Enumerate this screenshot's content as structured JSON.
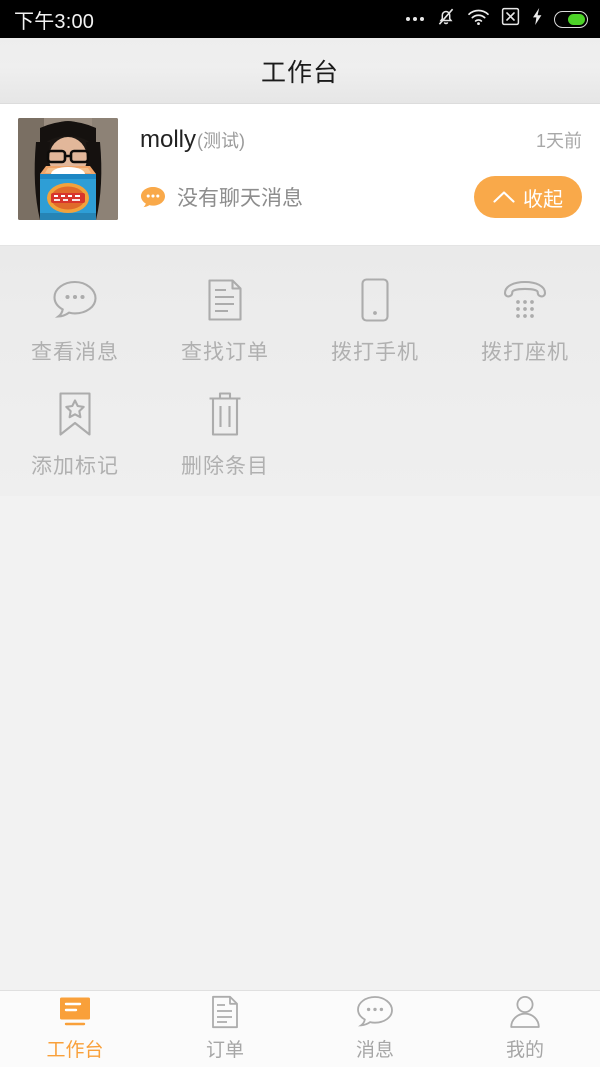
{
  "statusbar": {
    "time": "下午3:00",
    "icons": [
      "more-dots",
      "bell-muted-icon",
      "wifi-icon",
      "no-sim-icon",
      "charging-bolt-icon",
      "battery-icon"
    ]
  },
  "header": {
    "title": "工作台"
  },
  "contact_card": {
    "avatar_alt": "molly-avatar",
    "name": "molly",
    "name_suffix": "(测试)",
    "time_ago": "1天前",
    "message_icon": "chat-bubble-icon",
    "message": "没有聊天消息",
    "collapse_button": {
      "label": "收起",
      "icon": "chevron-up-icon",
      "color": "#F9A94A"
    }
  },
  "actions": {
    "rows": [
      [
        {
          "label": "查看消息",
          "icon": "chat-bubble-outline-icon"
        },
        {
          "label": "查找订单",
          "icon": "document-icon"
        },
        {
          "label": "拨打手机",
          "icon": "mobile-phone-icon"
        },
        {
          "label": "拨打座机",
          "icon": "landline-phone-icon"
        }
      ],
      [
        {
          "label": "添加标记",
          "icon": "bookmark-star-icon"
        },
        {
          "label": "删除条目",
          "icon": "trash-icon"
        }
      ]
    ],
    "label_color": "#B0B0B0"
  },
  "tabbar": {
    "active_color": "#F9A03A",
    "inactive_color": "#A6A6A6",
    "items": [
      {
        "label": "工作台",
        "icon": "workbench-icon",
        "active": true
      },
      {
        "label": "订单",
        "icon": "document-icon",
        "active": false
      },
      {
        "label": "消息",
        "icon": "chat-bubble-outline-icon",
        "active": false
      },
      {
        "label": "我的",
        "icon": "person-icon",
        "active": false
      }
    ]
  }
}
